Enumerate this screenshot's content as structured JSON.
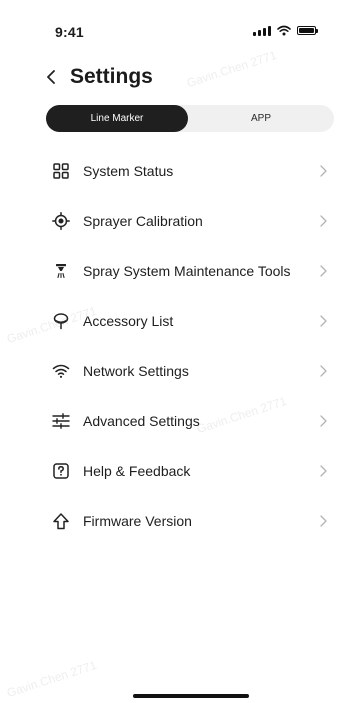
{
  "status_bar": {
    "time": "9:41"
  },
  "header": {
    "title": "Settings"
  },
  "segmented": {
    "active": "Line Marker",
    "inactive": "APP"
  },
  "menu": [
    {
      "label": "System Status",
      "icon": "grid-icon"
    },
    {
      "label": "Sprayer Calibration",
      "icon": "crosshair-icon"
    },
    {
      "label": "Spray System Maintenance Tools",
      "icon": "spray-nozzle-icon"
    },
    {
      "label": "Accessory List",
      "icon": "accessory-icon"
    },
    {
      "label": "Network Settings",
      "icon": "wifi-icon"
    },
    {
      "label": "Advanced Settings",
      "icon": "sliders-icon"
    },
    {
      "label": "Help & Feedback",
      "icon": "help-icon"
    },
    {
      "label": "Firmware Version",
      "icon": "upload-arrow-icon"
    }
  ],
  "watermark": {
    "text": "Gavin.Chen 2771"
  }
}
